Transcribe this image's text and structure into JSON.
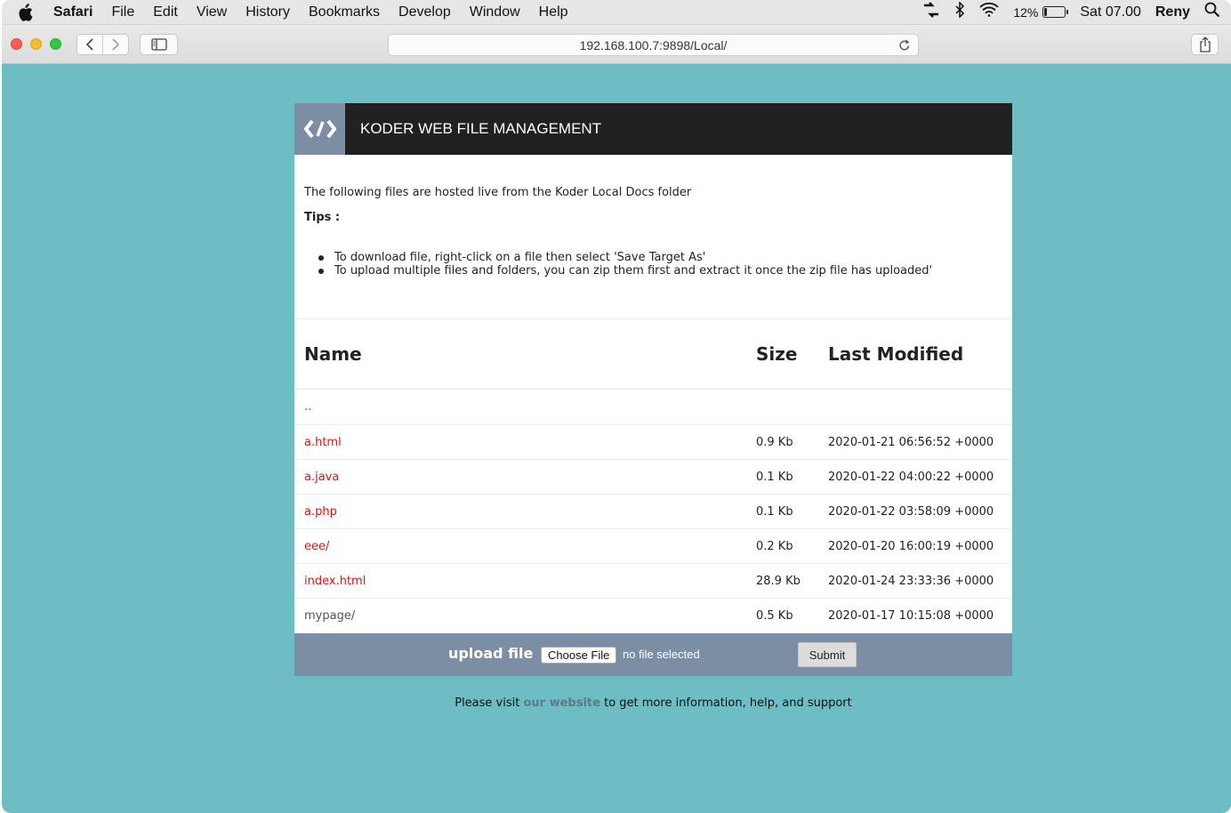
{
  "menubar": {
    "app_name": "Safari",
    "items": [
      "File",
      "Edit",
      "View",
      "History",
      "Bookmarks",
      "Develop",
      "Window",
      "Help"
    ],
    "battery_percent": "12%",
    "battery_level": 0.12,
    "clock": "Sat 07.00",
    "user": "Reny"
  },
  "browser": {
    "url": "192.168.100.7:9898/Local/"
  },
  "page": {
    "header_title": "KODER WEB FILE MANAGEMENT",
    "intro_text": "The following files are hosted live from the Koder Local Docs folder",
    "tips_label": "Tips :",
    "tips": [
      "To download file, right-click on a file then select 'Save Target As'",
      "To upload multiple files and folders, you can zip them first and extract it once the zip file has uploaded'"
    ],
    "table": {
      "headers": {
        "name": "Name",
        "size": "Size",
        "modified": "Last Modified"
      },
      "parent_link": "..",
      "rows": [
        {
          "name": "a.html",
          "size": "0.9 Kb",
          "modified": "2020-01-21 06:56:52 +0000"
        },
        {
          "name": "a.java",
          "size": "0.1 Kb",
          "modified": "2020-01-22 04:00:22 +0000"
        },
        {
          "name": "a.php",
          "size": "0.1 Kb",
          "modified": "2020-01-22 03:58:09 +0000"
        },
        {
          "name": "eee/",
          "size": "0.2 Kb",
          "modified": "2020-01-20 16:00:19 +0000"
        },
        {
          "name": "index.html",
          "size": "28.9 Kb",
          "modified": "2020-01-24 23:33:36 +0000"
        },
        {
          "name": "mypage/",
          "size": "0.5 Kb",
          "modified": "2020-01-17 10:15:08 +0000"
        }
      ]
    },
    "upload": {
      "label": "upload file",
      "choose_button": "Choose File",
      "no_file_text": "no file selected",
      "submit_button": "Submit"
    },
    "footer": {
      "prefix": "Please visit",
      "link_text": "our website",
      "suffix": "to get more information, help, and support"
    }
  },
  "colors": {
    "page_background": "#6ebcc4",
    "header_background": "#212121",
    "accent_slate": "#7b8ea4",
    "link_red": "#e01010",
    "visited_gray": "#555555"
  }
}
